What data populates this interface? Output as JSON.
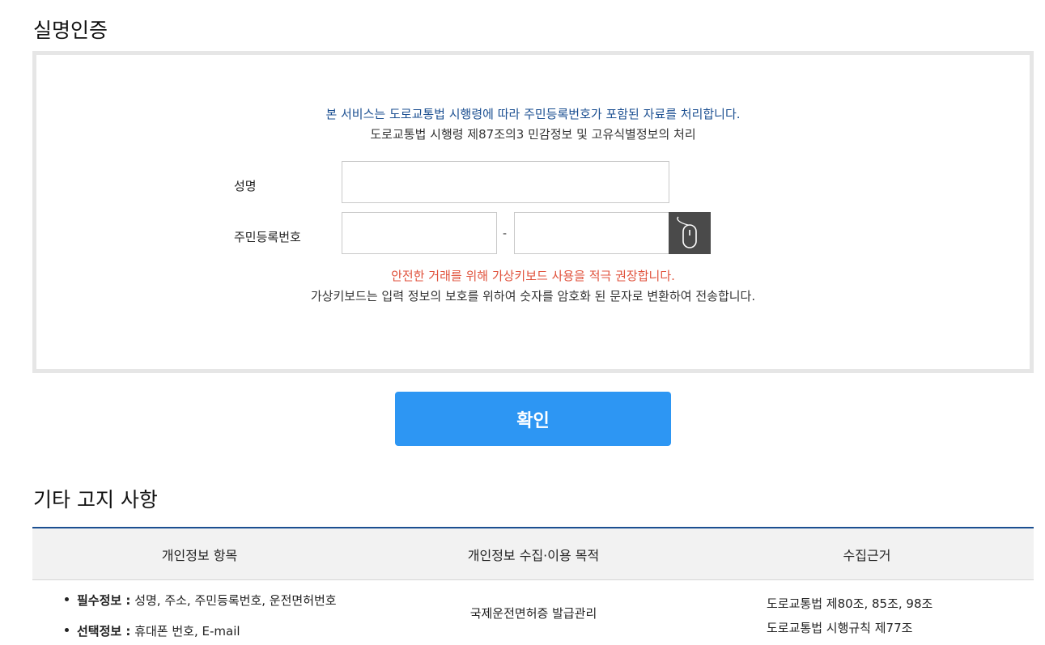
{
  "auth": {
    "title": "실명인증",
    "notice_blue": "본 서비스는 도로교통법 시행령에 따라 주민등록번호가 포함된 자료를 처리합니다.",
    "notice_dark": "도로교통법 시행령 제87조의3 민감정보 및 고유식별정보의 처리",
    "name_label": "성명",
    "name_value": "",
    "rrn_label": "주민등록번호",
    "rrn_front_value": "",
    "rrn_back_value": "",
    "rrn_separator": "-",
    "virtual_keyboard_icon": "mouse-icon",
    "warn_red": "안전한 거래를 위해 가상키보드 사용을 적극 권장합니다.",
    "warn_dark": "가상키보드는 입력 정보의 보호를 위하여 숫자를 암호화 된 문자로 변환하여 전송합니다.",
    "confirm_label": "확인"
  },
  "notice": {
    "title": "기타 고지 사항",
    "columns": [
      "개인정보 항목",
      "개인정보 수집·이용 목적",
      "수집근거"
    ],
    "items": [
      {
        "label": "필수정보 :",
        "value": " 성명, 주소, 주민등록번호, 운전면허번호"
      },
      {
        "label": "선택정보 :",
        "value": " 휴대폰 번호, E-mail"
      }
    ],
    "purpose": "국제운전면허증 발급관리",
    "basis": [
      "도로교통법 제80조, 85조, 98조",
      "도로교통법 시행규칙 제77조"
    ]
  },
  "colors": {
    "accent": "#2d96f3",
    "notice_blue": "#1b4f91",
    "warning": "#e0523c",
    "table_border": "#1b4f91"
  }
}
